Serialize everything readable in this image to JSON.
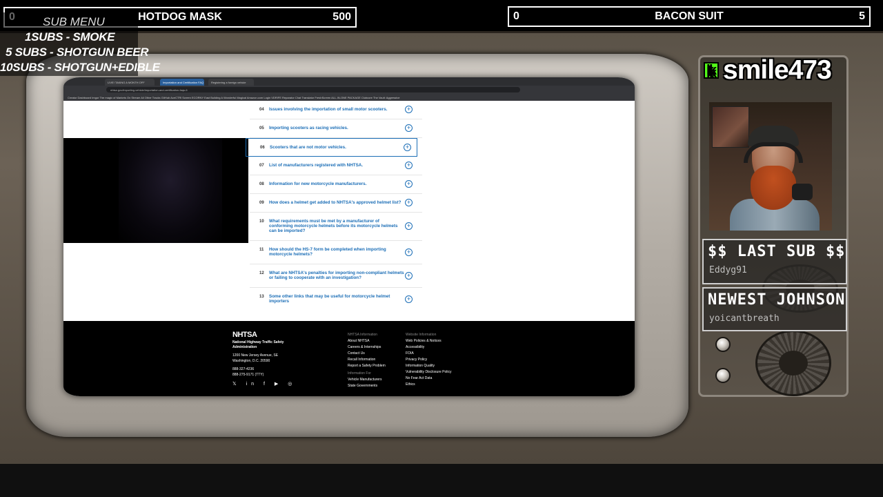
{
  "left_bar": {
    "count": "0",
    "title": "HOTDOG MASK",
    "goal": "500"
  },
  "right_bar": {
    "count": "0",
    "title": "BACON SUIT",
    "goal": "5"
  },
  "sub_menu": {
    "title": "SUB MENU",
    "lines": [
      "1SUBS   - SMOKE",
      "5 SUBS  - SHOTGUN BEER",
      "10SUBS - SHOTGUN+EDIBLE"
    ]
  },
  "streamer": {
    "platform_icon": "kick-icon",
    "platform_letter": "k",
    "name": "smile473"
  },
  "last_sub": {
    "label": "$$ LAST SUB $$",
    "name": "Eddyg91"
  },
  "newest": {
    "label": "NEWEST JOHNSON",
    "name": "yoicantbreath"
  },
  "browser": {
    "tabs": [
      "LIVE! TAKING A MONTH OFF",
      "Importation and Certification FAQ",
      "Registering a foreign vehicle"
    ],
    "url": "nhtsa.gov/importing-vehicle/importation-and-certification-faqs-6",
    "bookmarks": "Creator Dashboard  Imgur The magic of  Markets On Stream  All Other Tracks  GitHub  AceCTRl Screen  ECORNY East Building  A Wonderful Magical  Amazon.com Login  VDRIFE Reparator  Chat Translator  FreshScreen  ALL-IN-ONE PACKAGE  Clubcore  The Vault: Aggressive"
  },
  "faq": [
    {
      "num": "04",
      "q": "Issues involving the importation of small motor scooters."
    },
    {
      "num": "05",
      "q": "Importing scooters as racing vehicles."
    },
    {
      "num": "06",
      "q": "Scooters that are not motor vehicles."
    },
    {
      "num": "07",
      "q": "List of manufacturers registered with NHTSA."
    },
    {
      "num": "08",
      "q": "Information for new motorcycle manufacturers."
    },
    {
      "num": "09",
      "q": "How does a helmet get added to NHTSA's approved helmet list?"
    },
    {
      "num": "10",
      "q": "What requirements must be met by a manufacturer of conforming motorcycle helmets before its motorcycle helmets can be imported?"
    },
    {
      "num": "11",
      "q": "How should the HS-7 form be completed when importing motorcycle helmets?"
    },
    {
      "num": "12",
      "q": "What are NHTSA's penalties for importing non-compliant helmets or failing to cooperate with an investigation?"
    },
    {
      "num": "13",
      "q": "Some other links that may be useful for motorcycle helmet importers"
    }
  ],
  "footer": {
    "logo": "NHTSA",
    "org": "National Highway Traffic Safety Administration",
    "address1": "1200 New Jersey Avenue, SE",
    "address2": "Washington, D.C. 20590",
    "phone1": "888-327-4236",
    "phone2": "888-275-9171 (TTY)",
    "col1_head": "NHTSA Information",
    "col1": [
      "About NHTSA",
      "Careers & Internships",
      "Contact Us",
      "Recall Information",
      "Report a Safety Problem"
    ],
    "col1b_head": "Information For",
    "col1b": [
      "Vehicle Manufacturers",
      "State Governments"
    ],
    "col2_head": "Website Information",
    "col2": [
      "Web Policies & Notices",
      "Accessibility",
      "FOIA",
      "Privacy Policy",
      "Information Quality",
      "Vulnerability Disclosure Policy",
      "No Fear Act Data",
      "Ethics"
    ],
    "social": "𝕏 in f ▶ ◎"
  }
}
